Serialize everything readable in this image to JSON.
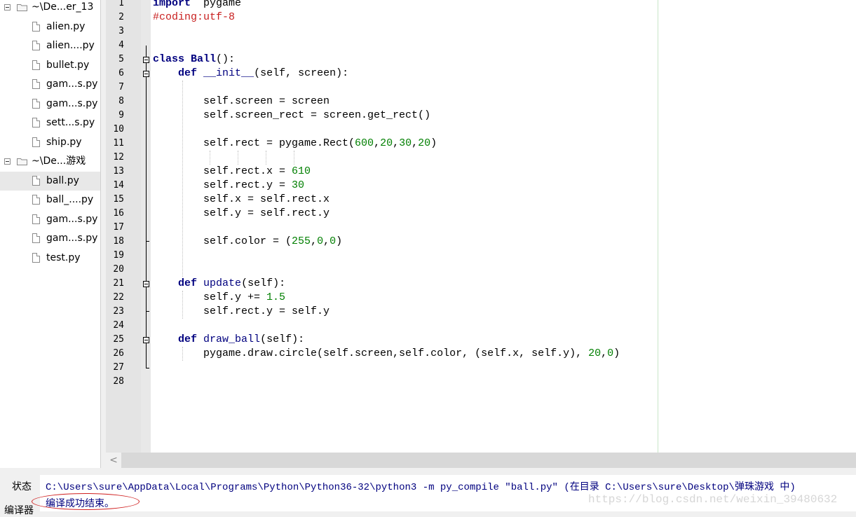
{
  "sidebar": {
    "items": [
      {
        "type": "folder",
        "label": "~\\De...er_13"
      },
      {
        "type": "file",
        "label": "alien.py"
      },
      {
        "type": "file",
        "label": "alien....py"
      },
      {
        "type": "file",
        "label": "bullet.py"
      },
      {
        "type": "file",
        "label": "gam...s.py"
      },
      {
        "type": "file",
        "label": "gam...s.py"
      },
      {
        "type": "file",
        "label": "sett...s.py"
      },
      {
        "type": "file",
        "label": "ship.py"
      },
      {
        "type": "folder",
        "label": "~\\De...游戏"
      },
      {
        "type": "file",
        "label": "ball.py",
        "selected": true
      },
      {
        "type": "file",
        "label": "ball_....py"
      },
      {
        "type": "file",
        "label": "gam...s.py"
      },
      {
        "type": "file",
        "label": "gam...s.py"
      },
      {
        "type": "file",
        "label": "test.py"
      }
    ]
  },
  "editor": {
    "line_numbers": [
      "1",
      "2",
      "3",
      "4",
      "5",
      "6",
      "7",
      "8",
      "9",
      "10",
      "11",
      "12",
      "13",
      "14",
      "15",
      "16",
      "17",
      "18",
      "19",
      "20",
      "21",
      "22",
      "23",
      "24",
      "25",
      "26",
      "27",
      "28"
    ],
    "code": [
      [
        [
          "kw",
          "import"
        ],
        [
          "",
          "  pygame"
        ]
      ],
      [
        [
          "cmt",
          "#coding:utf-8"
        ]
      ],
      [],
      [],
      [
        [
          "kw",
          "class"
        ],
        [
          "",
          " "
        ],
        [
          "cls",
          "Ball"
        ],
        [
          "",
          "():"
        ]
      ],
      [
        [
          "",
          "    "
        ],
        [
          "kw",
          "def"
        ],
        [
          "",
          " "
        ],
        [
          "fn",
          "__init__"
        ],
        [
          "",
          "(self, screen):"
        ]
      ],
      [],
      [
        [
          "",
          "        self.screen = screen"
        ]
      ],
      [
        [
          "",
          "        self.screen_rect = screen.get_rect()"
        ]
      ],
      [],
      [
        [
          "",
          "        self.rect = pygame.Rect("
        ],
        [
          "num",
          "600"
        ],
        [
          "",
          ","
        ],
        [
          "num",
          "20"
        ],
        [
          "",
          ","
        ],
        [
          "num",
          "30"
        ],
        [
          "",
          ","
        ],
        [
          "num",
          "20"
        ],
        [
          "",
          ")"
        ]
      ],
      [],
      [
        [
          "",
          "        self.rect.x = "
        ],
        [
          "num",
          "610"
        ]
      ],
      [
        [
          "",
          "        self.rect.y = "
        ],
        [
          "num",
          "30"
        ]
      ],
      [
        [
          "",
          "        self.x = self.rect.x"
        ]
      ],
      [
        [
          "",
          "        self.y = self.rect.y"
        ]
      ],
      [],
      [
        [
          "",
          "        self.color = ("
        ],
        [
          "num",
          "255"
        ],
        [
          "",
          ","
        ],
        [
          "num",
          "0"
        ],
        [
          "",
          ","
        ],
        [
          "num",
          "0"
        ],
        [
          "",
          ")"
        ]
      ],
      [],
      [],
      [
        [
          "",
          "    "
        ],
        [
          "kw",
          "def"
        ],
        [
          "",
          " "
        ],
        [
          "fn",
          "update"
        ],
        [
          "",
          "(self):"
        ]
      ],
      [
        [
          "",
          "        self.y += "
        ],
        [
          "num",
          "1.5"
        ]
      ],
      [
        [
          "",
          "        self.rect.y = self.y"
        ]
      ],
      [],
      [
        [
          "",
          "    "
        ],
        [
          "kw",
          "def"
        ],
        [
          "",
          " "
        ],
        [
          "fn",
          "draw_ball"
        ],
        [
          "",
          "(self):"
        ]
      ],
      [
        [
          "",
          "        pygame.draw.circle(self.screen,self.color, (self.x, self.y), "
        ],
        [
          "num",
          "20"
        ],
        [
          "",
          ","
        ],
        [
          "num",
          "0"
        ],
        [
          "",
          ")"
        ]
      ],
      [],
      []
    ]
  },
  "output": {
    "status_tab": "状态",
    "compiler_tab": "编译器",
    "line1": "C:\\Users\\sure\\AppData\\Local\\Programs\\Python\\Python36-32\\python3 -m py_compile \"ball.py\" (在目录 C:\\Users\\sure\\Desktop\\弹珠游戏 中)",
    "line2": "编译成功结束。",
    "watermark": "https://blog.csdn.net/weixin_39480632"
  },
  "scrollbar": {
    "left_arrow": "<"
  }
}
